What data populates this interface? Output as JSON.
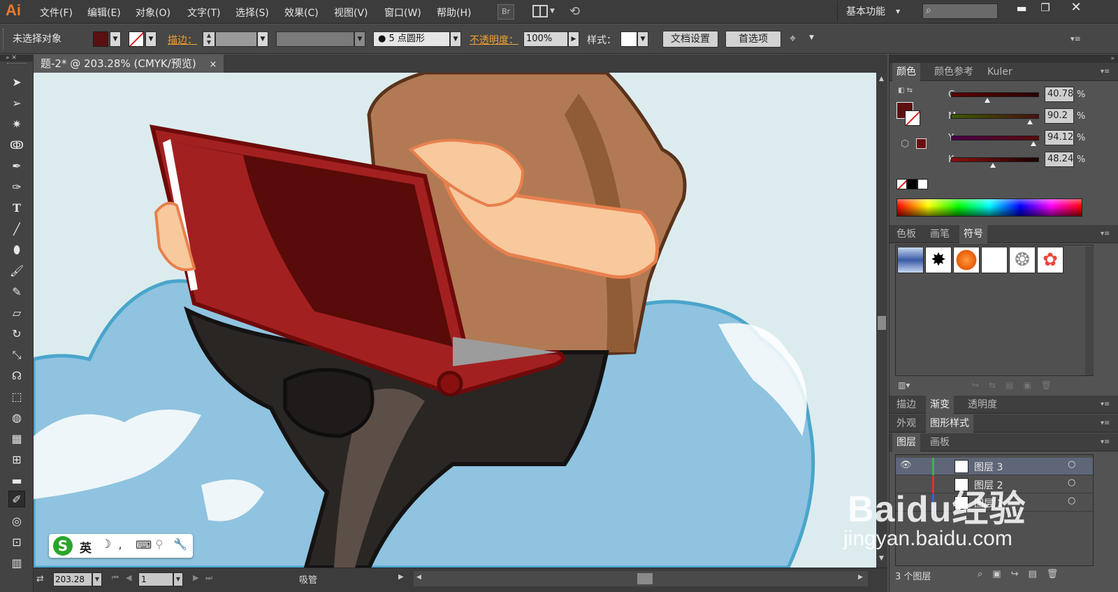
{
  "app": {
    "logo": "Ai"
  },
  "menu": [
    "文件(F)",
    "编辑(E)",
    "对象(O)",
    "文字(T)",
    "选择(S)",
    "效果(C)",
    "视图(V)",
    "窗口(W)",
    "帮助(H)"
  ],
  "menubar_right": {
    "br_label": "Br",
    "workspace": "基本功能",
    "search_placeholder": ""
  },
  "control_bar": {
    "selection_status": "未选择对象",
    "stroke_label": "描边：",
    "brush_label": "5 点圆形",
    "opacity_label": "不透明度：",
    "opacity_value": "100%",
    "style_label": "样式：",
    "doc_setup_button": "文档设置",
    "prefs_button": "首选项"
  },
  "document": {
    "tab_title": "题-2* @ 203.28% (CMYK/预览)",
    "close_glyph": "×"
  },
  "status": {
    "zoom": "203.28",
    "artboard": "1",
    "tool_name": "吸管"
  },
  "color_panel": {
    "tabs": [
      "颜色",
      "颜色参考",
      "Kuler"
    ],
    "channels": [
      {
        "label": "C",
        "value": "40.78",
        "level": 0.41
      },
      {
        "label": "M",
        "value": "90.2",
        "level": 0.9
      },
      {
        "label": "Y",
        "value": "94.12",
        "level": 0.94
      },
      {
        "label": "K",
        "value": "48.24",
        "level": 0.48
      }
    ],
    "percent": "%",
    "fill_color": "#5a1010"
  },
  "swatch_panel": {
    "tabs": [
      "色板",
      "画笔",
      "符号"
    ]
  },
  "stroke_panel": {
    "tabs": [
      "描边",
      "渐变",
      "透明度"
    ]
  },
  "appearance_panel": {
    "tabs": [
      "外观",
      "图形样式"
    ]
  },
  "layers_panel": {
    "tabs": [
      "图层",
      "画板"
    ],
    "layers": [
      {
        "name": "图层 3",
        "color": "#3cb44b"
      },
      {
        "name": "图层 2",
        "color": "#e03030"
      },
      {
        "name": "图层 1",
        "color": "#3060e0"
      }
    ],
    "count_label": "3 个图层"
  },
  "ime": {
    "mode": "英"
  },
  "watermark": {
    "brand": "Baidu经验",
    "url": "jingyan.baidu.com"
  }
}
